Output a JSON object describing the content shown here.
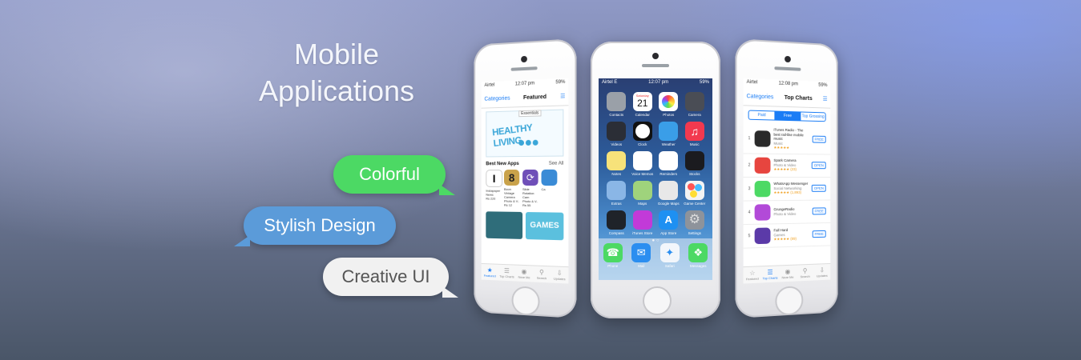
{
  "headline": {
    "line1": "Mobile",
    "line2": "Applications"
  },
  "bubbles": {
    "colorful": "Colorful",
    "stylish": "Stylish Design",
    "creative": "Creative UI"
  },
  "colors": {
    "green": "#4cd964",
    "blue": "#5b9bd9",
    "ios_blue": "#1a7cf5"
  },
  "phone_left": {
    "status": {
      "carrier": "Airtel",
      "time": "12:07 pm",
      "battery": "59%"
    },
    "nav": {
      "left": "Categories",
      "title": "Featured"
    },
    "banner": {
      "tag": "Essentials",
      "art": "HEALTHY LIVING"
    },
    "section": {
      "title": "Best New Apps",
      "see_all": "See All"
    },
    "apps": [
      {
        "name": "Instapaper",
        "sub": "News",
        "price": "Rs 220",
        "color": "#ffffff"
      },
      {
        "name": "Boon Vintage Camera",
        "sub": "Photo & V..",
        "price": "Rs 12",
        "color": "#c9a24a"
      },
      {
        "name": "Slide Rotation Cam",
        "sub": "Photo & V..",
        "price": "Rs 55",
        "color": "#6f4fb8"
      },
      {
        "name": "Ca",
        "sub": "",
        "price": "",
        "color": "#3a8bd6"
      }
    ],
    "promos": [
      {
        "label": "",
        "color": "#2f6d7a"
      },
      {
        "label": "GAMES",
        "color": "#5bc0de"
      }
    ],
    "tabs": [
      {
        "icon": "star",
        "label": "Featured"
      },
      {
        "icon": "list",
        "label": "Top Charts"
      },
      {
        "icon": "compass",
        "label": "Near Me"
      },
      {
        "icon": "search",
        "label": "Search"
      },
      {
        "icon": "updates",
        "label": "Updates"
      }
    ]
  },
  "phone_mid": {
    "status": {
      "carrier": "Airtel",
      "network": "E",
      "time": "12:07 pm",
      "battery": "59%"
    },
    "calendar_day": "Saturday",
    "calendar_date": "21",
    "apps": [
      {
        "label": "Contacts",
        "color": "#9aa0a8"
      },
      {
        "label": "Calendar",
        "color": "#ffffff"
      },
      {
        "label": "Photos",
        "color": "#ffffff"
      },
      {
        "label": "Camera",
        "color": "#4a4d55"
      },
      {
        "label": "Videos",
        "color": "#2b2e36"
      },
      {
        "label": "Clock",
        "color": "#111111"
      },
      {
        "label": "Weather",
        "color": "#3a9ee8"
      },
      {
        "label": "Music",
        "color": "#f2394f"
      },
      {
        "label": "Notes",
        "color": "#f7e27a"
      },
      {
        "label": "Voice Memos",
        "color": "#ffffff"
      },
      {
        "label": "Reminders",
        "color": "#ffffff"
      },
      {
        "label": "Stocks",
        "color": "#1b1b1f"
      },
      {
        "label": "Extras",
        "color": "#8ab6e6"
      },
      {
        "label": "Maps",
        "color": "#9fd37c"
      },
      {
        "label": "Google Maps",
        "color": "#e8e8e8"
      },
      {
        "label": "Game Center",
        "color": "#f3f3f3"
      },
      {
        "label": "Compass",
        "color": "#1f2329"
      },
      {
        "label": "iTunes Store",
        "color": "#c23ad8"
      },
      {
        "label": "App Store",
        "color": "#1e90f2"
      },
      {
        "label": "Settings",
        "color": "#8e939b"
      }
    ],
    "dock": [
      {
        "label": "Phone",
        "color": "#4cd964"
      },
      {
        "label": "Mail",
        "color": "#2b8ef0"
      },
      {
        "label": "Safari",
        "color": "#f2f6fb"
      },
      {
        "label": "Messages",
        "color": "#4cd964"
      }
    ]
  },
  "phone_right": {
    "status": {
      "carrier": "Airtel",
      "time": "12:08 pm",
      "battery": "59%"
    },
    "nav": {
      "left": "Categories",
      "title": "Top Charts"
    },
    "segments": [
      "Paid",
      "Free",
      "Top Grossing"
    ],
    "rows": [
      {
        "rank": "1",
        "name": "iTunes Radio - The best rail-like mobile music",
        "sub": "Music",
        "stars": "★★★★★",
        "button": "FREE",
        "color": "#2a2a2a"
      },
      {
        "rank": "2",
        "name": "Spark Camera",
        "sub": "Photo & Video",
        "stars": "★★★★★ (23)",
        "button": "OPEN",
        "color": "#e7453f"
      },
      {
        "rank": "3",
        "name": "WhatsApp Messenger",
        "sub": "Social Networking",
        "stars": "★★★★★ (1,893)",
        "button": "OPEN",
        "color": "#4cd964"
      },
      {
        "rank": "4",
        "name": "GrungeRadio",
        "sub": "Photo & Video",
        "stars": "",
        "button": "FREE",
        "color": "#b24ad8"
      },
      {
        "rank": "5",
        "name": "Fall Hard",
        "sub": "Games",
        "stars": "★★★★★ (89)",
        "button": "FREE",
        "color": "#5b3aa8"
      }
    ],
    "tabs": [
      {
        "icon": "star",
        "label": "Featured"
      },
      {
        "icon": "list",
        "label": "Top Charts"
      },
      {
        "icon": "compass",
        "label": "Near Me"
      },
      {
        "icon": "search",
        "label": "Search"
      },
      {
        "icon": "updates",
        "label": "Updates"
      }
    ]
  }
}
